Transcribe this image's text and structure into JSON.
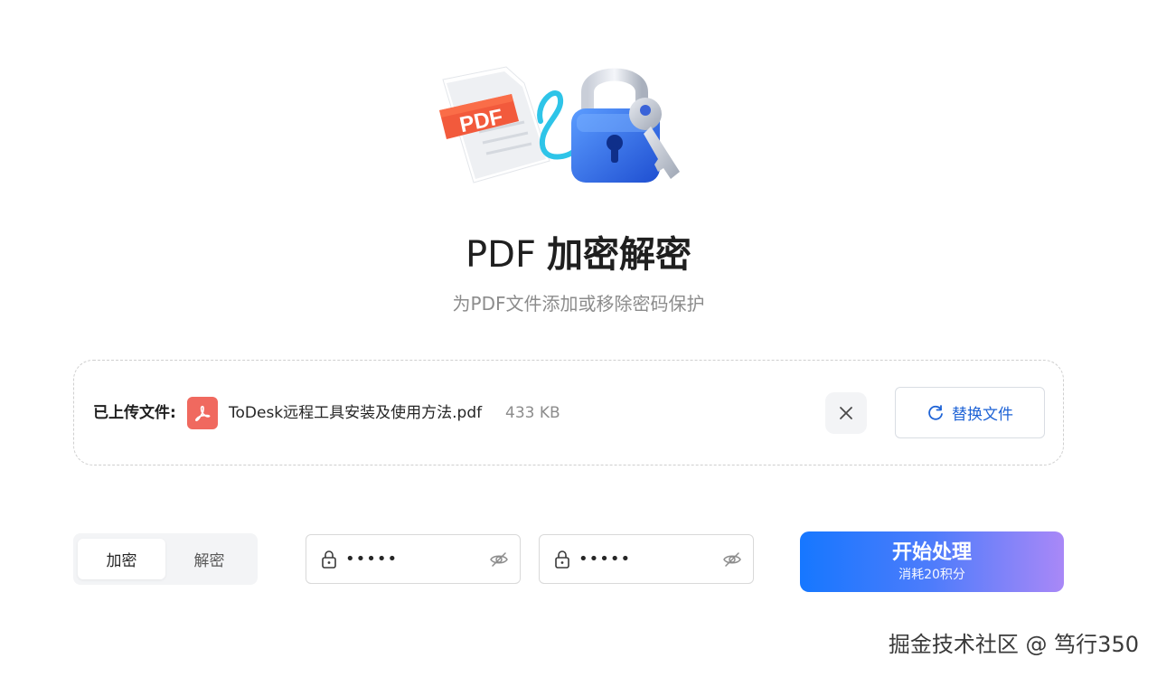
{
  "page": {
    "title_prefix": "PDF",
    "title_main": "加密解密",
    "subtitle": "为PDF文件添加或移除密码保护"
  },
  "hero": {
    "pdf_badge_text": "PDF",
    "icons": [
      "pdf-document-icon",
      "padlock-icon",
      "key-icon"
    ]
  },
  "upload": {
    "label": "已上传文件:",
    "file_icon": "pdf-file-icon",
    "file_name": "ToDesk远程工具安装及使用方法.pdf",
    "file_size": "433 KB",
    "close_icon": "close-icon",
    "replace_label": "替换文件",
    "replace_icon": "refresh-icon"
  },
  "mode": {
    "tabs": [
      {
        "label": "加密",
        "active": true
      },
      {
        "label": "解密",
        "active": false
      }
    ]
  },
  "password_fields": [
    {
      "value": "•••••",
      "lock_icon": "lock-icon",
      "visibility_icon": "eye-off-icon"
    },
    {
      "value": "•••••",
      "lock_icon": "lock-icon",
      "visibility_icon": "eye-off-icon"
    }
  ],
  "start": {
    "label": "开始处理",
    "cost": "消耗20积分"
  },
  "watermark": "掘金技术社区 @ 笃行350",
  "colors": {
    "accent_blue": "#1e63d6",
    "gradient_start": "#1677ff",
    "gradient_end": "#a988f7",
    "pdf_red": "#f0695f"
  }
}
